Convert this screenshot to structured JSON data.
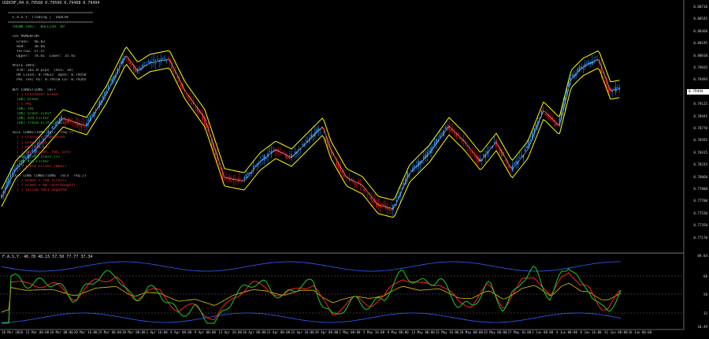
{
  "header": {
    "title": "USDCHF,H4  0.79568 0.79599 0.79468 0.79494",
    "osc_title": "F.A.S.Y. 46.78 48.15 57.50 77.77 37.34"
  },
  "panel": {
    "lines": [
      {
        "t": "=======================================",
        "c": "grey"
      },
      {
        "t": "  F.A.S.Y. Trading |  USDCHF",
        "c": "grey"
      },
      {
        "t": "=======================================",
        "c": "grey"
      },
      {
        "t": "  TREND [H4]:  BULLISH  UP",
        "c": "green"
      },
      {
        "t": "",
        "c": "grey"
      },
      {
        "t": "  TDI MOMENTUM:",
        "c": "grey"
      },
      {
        "t": "    Green:  46.83",
        "c": "grey"
      },
      {
        "t": "    Red:    38.66",
        "c": "grey"
      },
      {
        "t": "    Yellow: 57.57",
        "c": "grey"
      },
      {
        "t": "    Upper:  78.01  Lower: 35.92",
        "c": "grey"
      },
      {
        "t": "",
        "c": "grey"
      },
      {
        "t": "  PRICE INFO:",
        "c": "grey"
      },
      {
        "t": "    ATR: 161.0 pips  (min: 10)",
        "c": "grey"
      },
      {
        "t": "    HA Close: 0.79632  Open: 0.79458",
        "c": "grey"
      },
      {
        "t": "    PAC (en) Hi: 0.79510 Lo: 0.79265",
        "c": "grey"
      },
      {
        "t": "",
        "c": "grey"
      },
      {
        "t": "  BUY CONDITIONS  [0/7",
        "c": "grey"
      },
      {
        "t": "    [ ] Crossover Green",
        "c": "red"
      },
      {
        "t": "    [OK] Green",
        "c": "green"
      },
      {
        "t": "    [ ] PAC",
        "c": "red"
      },
      {
        "t": "    [OK] TDI",
        "c": "green"
      },
      {
        "t": "    [OK] Green Limit",
        "c": "green"
      },
      {
        "t": "    [OK] ATR Filter",
        "c": "green"
      },
      {
        "t": "    [OK] Trend Filter (Bull)",
        "c": "green"
      },
      {
        "t": "",
        "c": "grey"
      },
      {
        "t": "  SELL CONDITIONS [3/7  req:7]",
        "c": "grey"
      },
      {
        "t": "    [ ] Crossover Greenred",
        "c": "red"
      },
      {
        "t": "    [ ] Green Ydn1",
        "c": "red"
      },
      {
        "t": "    [ ] PAC (Below)",
        "c": "red"
      },
      {
        "t": "    [ ] TDI (Green, Ydn, Grn)",
        "c": "red"
      },
      {
        "t": "    [OK] Green Limit (<)",
        "c": "green"
      },
      {
        "t": "    [OK] ATR Filter",
        "c": "green"
      },
      {
        "t": "    [ ] Trend Filter (Bear)",
        "c": "red"
      },
      {
        "t": "",
        "c": "grey"
      },
      {
        "t": "  EXIT LONG CONDITIONS  [0/3  req:2]",
        "c": "grey"
      },
      {
        "t": "    [ ] Green < red (Cross)",
        "c": "red"
      },
      {
        "t": "    [ ] Green > 68 (overbought)",
        "c": "red"
      },
      {
        "t": "    [ ] Yellow Ydn1 negated",
        "c": "red"
      }
    ]
  },
  "price_axis": [
    "0.80710",
    "0.80545",
    "0.80360",
    "0.80195",
    "0.80010",
    "0.79835",
    "0.79494",
    "0.79300",
    "0.79125",
    "0.78945",
    "0.78770",
    "0.78595",
    "0.78415",
    "0.78235",
    "0.78060",
    "0.77880",
    "0.77700",
    "0.77530",
    "0.77350",
    "0.77170"
  ],
  "current_price": "0.79494",
  "osc_axis": [
    "89.84",
    "68",
    "50",
    "32",
    "10.49"
  ],
  "time_axis": [
    "10 Mar 2026",
    "13 Mar 08:00",
    "18 Mar 00:00",
    "20 Mar 16:00",
    "25 Mar 08:00",
    "30 Mar 00:00",
    "1 Apr 16:00",
    "6 Apr 08:00",
    "9 Apr 00:00",
    "13 Apr 16:00",
    "16 Apr 08:00",
    "21 Apr 00:00",
    "23 Apr 16:00",
    "28 Apr 08:00",
    "1 May 00:00",
    "5 May 16:00",
    "8 May 08:00",
    "13 May 00:00",
    "15 May 16:00",
    "20 May 08:00",
    "25 May 00:00",
    "27 May 16:00",
    "1 Jun 08:00",
    "4 Jun 00:00",
    "8 Jun 16:00",
    "11 Jun 08:00",
    "16 Jun 00:00"
  ],
  "colors": {
    "bull": "#1e90ff",
    "bear": "#e01010",
    "band": "#ffff00",
    "green_line": "#22cc22",
    "red_line": "#ff2020",
    "yellow_line": "#e0c000",
    "bb_line": "#3060ff"
  }
}
